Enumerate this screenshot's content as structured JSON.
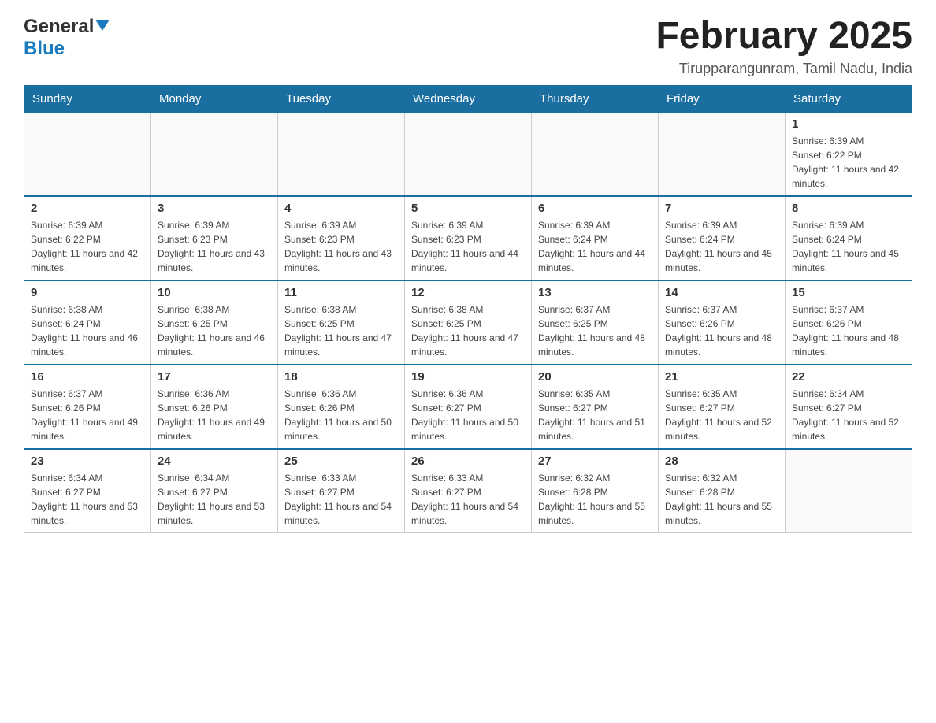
{
  "header": {
    "logo": {
      "general": "General",
      "blue": "Blue"
    },
    "title": "February 2025",
    "location": "Tirupparangunram, Tamil Nadu, India"
  },
  "days_of_week": [
    "Sunday",
    "Monday",
    "Tuesday",
    "Wednesday",
    "Thursday",
    "Friday",
    "Saturday"
  ],
  "weeks": [
    {
      "cells": [
        {
          "day": "",
          "info": ""
        },
        {
          "day": "",
          "info": ""
        },
        {
          "day": "",
          "info": ""
        },
        {
          "day": "",
          "info": ""
        },
        {
          "day": "",
          "info": ""
        },
        {
          "day": "",
          "info": ""
        },
        {
          "day": "1",
          "info": "Sunrise: 6:39 AM\nSunset: 6:22 PM\nDaylight: 11 hours and 42 minutes."
        }
      ]
    },
    {
      "cells": [
        {
          "day": "2",
          "info": "Sunrise: 6:39 AM\nSunset: 6:22 PM\nDaylight: 11 hours and 42 minutes."
        },
        {
          "day": "3",
          "info": "Sunrise: 6:39 AM\nSunset: 6:23 PM\nDaylight: 11 hours and 43 minutes."
        },
        {
          "day": "4",
          "info": "Sunrise: 6:39 AM\nSunset: 6:23 PM\nDaylight: 11 hours and 43 minutes."
        },
        {
          "day": "5",
          "info": "Sunrise: 6:39 AM\nSunset: 6:23 PM\nDaylight: 11 hours and 44 minutes."
        },
        {
          "day": "6",
          "info": "Sunrise: 6:39 AM\nSunset: 6:24 PM\nDaylight: 11 hours and 44 minutes."
        },
        {
          "day": "7",
          "info": "Sunrise: 6:39 AM\nSunset: 6:24 PM\nDaylight: 11 hours and 45 minutes."
        },
        {
          "day": "8",
          "info": "Sunrise: 6:39 AM\nSunset: 6:24 PM\nDaylight: 11 hours and 45 minutes."
        }
      ]
    },
    {
      "cells": [
        {
          "day": "9",
          "info": "Sunrise: 6:38 AM\nSunset: 6:24 PM\nDaylight: 11 hours and 46 minutes."
        },
        {
          "day": "10",
          "info": "Sunrise: 6:38 AM\nSunset: 6:25 PM\nDaylight: 11 hours and 46 minutes."
        },
        {
          "day": "11",
          "info": "Sunrise: 6:38 AM\nSunset: 6:25 PM\nDaylight: 11 hours and 47 minutes."
        },
        {
          "day": "12",
          "info": "Sunrise: 6:38 AM\nSunset: 6:25 PM\nDaylight: 11 hours and 47 minutes."
        },
        {
          "day": "13",
          "info": "Sunrise: 6:37 AM\nSunset: 6:25 PM\nDaylight: 11 hours and 48 minutes."
        },
        {
          "day": "14",
          "info": "Sunrise: 6:37 AM\nSunset: 6:26 PM\nDaylight: 11 hours and 48 minutes."
        },
        {
          "day": "15",
          "info": "Sunrise: 6:37 AM\nSunset: 6:26 PM\nDaylight: 11 hours and 48 minutes."
        }
      ]
    },
    {
      "cells": [
        {
          "day": "16",
          "info": "Sunrise: 6:37 AM\nSunset: 6:26 PM\nDaylight: 11 hours and 49 minutes."
        },
        {
          "day": "17",
          "info": "Sunrise: 6:36 AM\nSunset: 6:26 PM\nDaylight: 11 hours and 49 minutes."
        },
        {
          "day": "18",
          "info": "Sunrise: 6:36 AM\nSunset: 6:26 PM\nDaylight: 11 hours and 50 minutes."
        },
        {
          "day": "19",
          "info": "Sunrise: 6:36 AM\nSunset: 6:27 PM\nDaylight: 11 hours and 50 minutes."
        },
        {
          "day": "20",
          "info": "Sunrise: 6:35 AM\nSunset: 6:27 PM\nDaylight: 11 hours and 51 minutes."
        },
        {
          "day": "21",
          "info": "Sunrise: 6:35 AM\nSunset: 6:27 PM\nDaylight: 11 hours and 52 minutes."
        },
        {
          "day": "22",
          "info": "Sunrise: 6:34 AM\nSunset: 6:27 PM\nDaylight: 11 hours and 52 minutes."
        }
      ]
    },
    {
      "cells": [
        {
          "day": "23",
          "info": "Sunrise: 6:34 AM\nSunset: 6:27 PM\nDaylight: 11 hours and 53 minutes."
        },
        {
          "day": "24",
          "info": "Sunrise: 6:34 AM\nSunset: 6:27 PM\nDaylight: 11 hours and 53 minutes."
        },
        {
          "day": "25",
          "info": "Sunrise: 6:33 AM\nSunset: 6:27 PM\nDaylight: 11 hours and 54 minutes."
        },
        {
          "day": "26",
          "info": "Sunrise: 6:33 AM\nSunset: 6:27 PM\nDaylight: 11 hours and 54 minutes."
        },
        {
          "day": "27",
          "info": "Sunrise: 6:32 AM\nSunset: 6:28 PM\nDaylight: 11 hours and 55 minutes."
        },
        {
          "day": "28",
          "info": "Sunrise: 6:32 AM\nSunset: 6:28 PM\nDaylight: 11 hours and 55 minutes."
        },
        {
          "day": "",
          "info": ""
        }
      ]
    }
  ]
}
